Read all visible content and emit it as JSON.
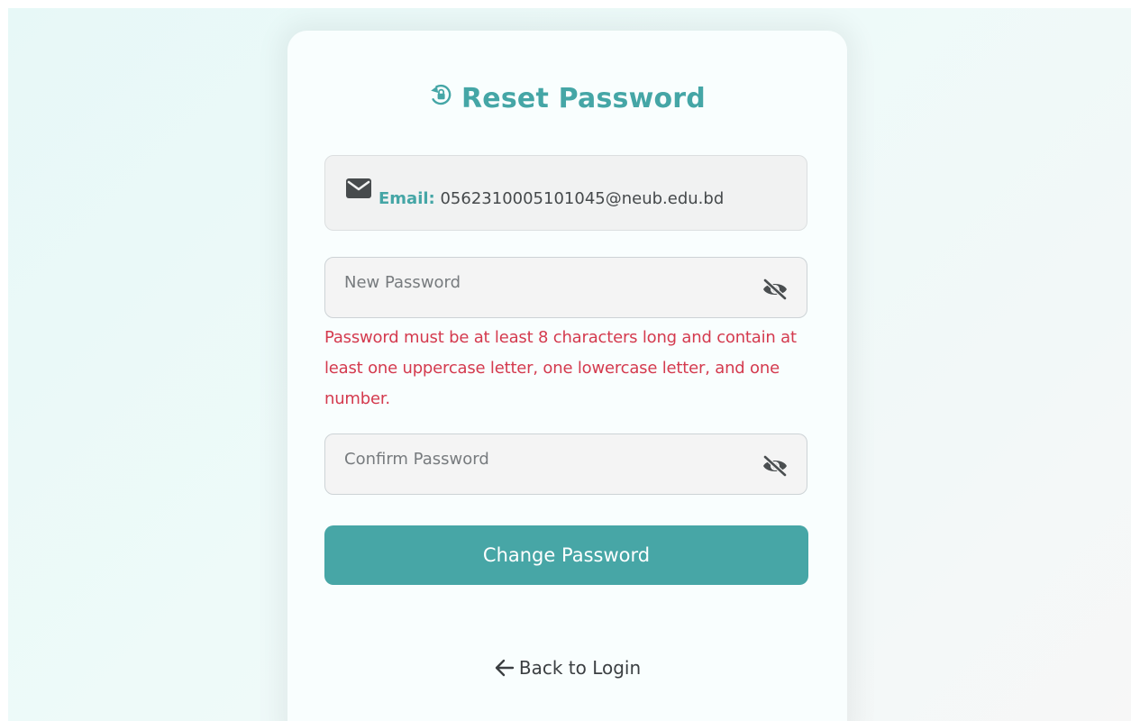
{
  "reset_form": {
    "title": "Reset Password",
    "email_label": "Email:",
    "email_value": "0562310005101045@neub.edu.bd",
    "new_password_placeholder": "New Password",
    "new_password_value": "",
    "password_error": "Password must be at least 8 characters long and contain at least one uppercase letter, one lowercase letter, and one number.",
    "confirm_password_placeholder": "Confirm Password",
    "confirm_password_value": "",
    "submit_label": "Change Password",
    "back_label": "Back to Login"
  },
  "icons": {
    "title": "lock-reset-icon",
    "email": "envelope-icon",
    "password_toggle": "eye-slash-icon",
    "back": "arrow-left-icon"
  },
  "colors": {
    "accent": "#47a6a6",
    "error": "#d43a4e",
    "text": "#3b3f42"
  }
}
